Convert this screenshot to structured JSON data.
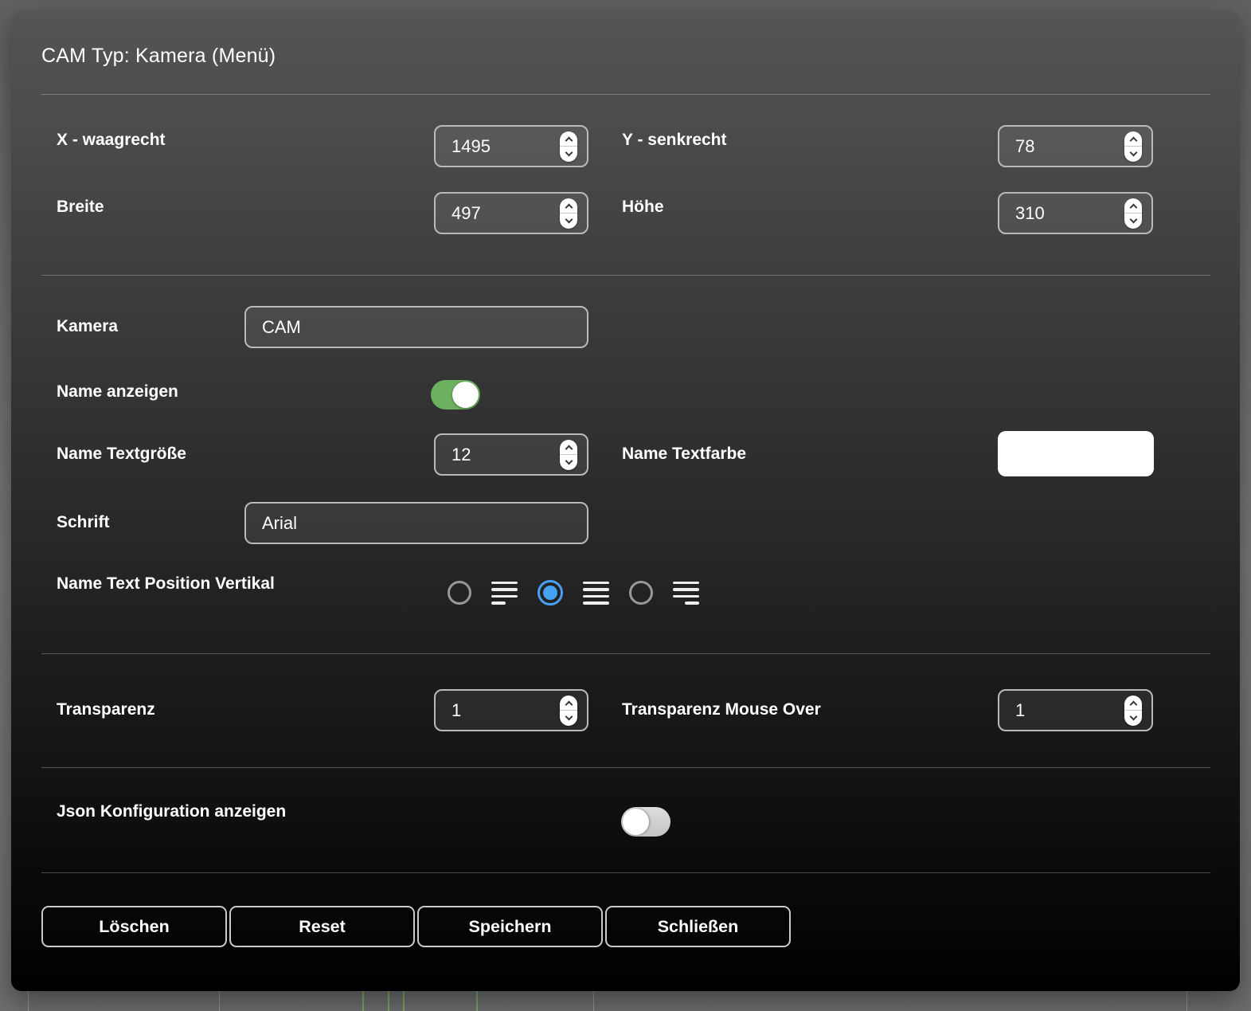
{
  "dialog": {
    "title": "CAM Typ: Kamera (Menü)",
    "fields": {
      "x": {
        "label": "X - waagrecht",
        "value": "1495"
      },
      "y": {
        "label": "Y - senkrecht",
        "value": "78"
      },
      "breite": {
        "label": "Breite",
        "value": "497"
      },
      "hoehe": {
        "label": "Höhe",
        "value": "310"
      },
      "kamera": {
        "label": "Kamera",
        "value": "CAM"
      },
      "name_anzeigen": {
        "label": "Name anzeigen",
        "state": "on"
      },
      "name_textgroesse": {
        "label": "Name Textgröße",
        "value": "12"
      },
      "name_textfarbe": {
        "label": "Name Textfarbe",
        "color": "#ffffff"
      },
      "schrift": {
        "label": "Schrift",
        "value": "Arial"
      },
      "name_text_position_vertikal": {
        "label": "Name Text Position Vertikal",
        "options": [
          "top",
          "middle",
          "bottom"
        ],
        "selected": "middle"
      },
      "transparenz": {
        "label": "Transparenz",
        "value": "1"
      },
      "transparenz_mouse_over": {
        "label": "Transparenz Mouse Over",
        "value": "1"
      },
      "json_konfiguration": {
        "label": "Json Konfiguration anzeigen",
        "state": "off"
      }
    },
    "buttons": {
      "loeschen": "Löschen",
      "reset": "Reset",
      "speichern": "Speichern",
      "schliessen": "Schließen"
    },
    "colors": {
      "toggle_on": "#6cb15f",
      "radio_selected": "#47a1f5",
      "field_border": "#b9babc",
      "swatch": "#ffffff"
    }
  }
}
